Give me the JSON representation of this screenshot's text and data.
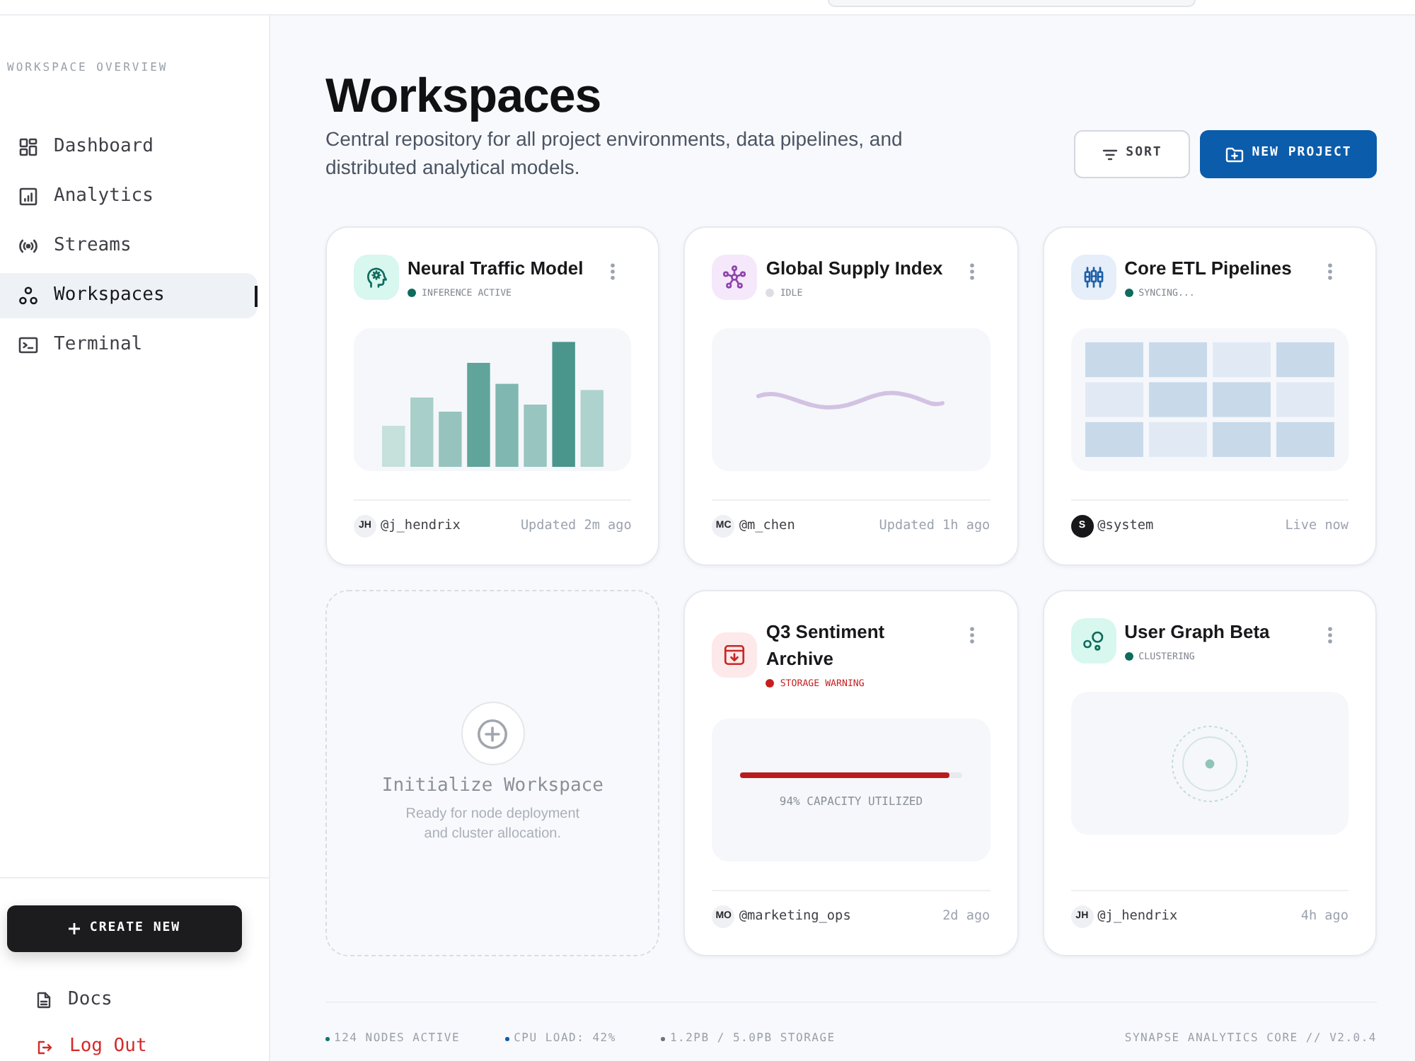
{
  "sidebar": {
    "heading": "WORKSPACE OVERVIEW",
    "nav": [
      {
        "label": "Dashboard",
        "selected": false
      },
      {
        "label": "Analytics",
        "selected": false
      },
      {
        "label": "Streams",
        "selected": false
      },
      {
        "label": "Workspaces",
        "selected": true
      },
      {
        "label": "Terminal",
        "selected": false
      }
    ],
    "create_button": "CREATE NEW",
    "links": [
      {
        "label": "Docs",
        "kind": "default"
      },
      {
        "label": "Log Out",
        "kind": "danger"
      }
    ]
  },
  "page": {
    "title": "Workspaces",
    "description": "Central repository for all project environments, data pipelines, and distributed analytical models.",
    "actions": [
      {
        "label": "SORT",
        "kind": "secondary"
      },
      {
        "label": "NEW PROJECT",
        "kind": "primary"
      }
    ]
  },
  "cards": [
    {
      "kind": "project",
      "title": "Neural Traffic Model",
      "status": {
        "label": "INFERENCE ACTIVE",
        "color": "#0f6b5c",
        "warning": false
      },
      "preview": {
        "kind": "bars"
      },
      "owner": {
        "initials": "JH",
        "handle": "@j_hendrix",
        "kind": "user"
      },
      "updated": "Updated 2m ago"
    },
    {
      "kind": "project",
      "title": "Global Supply Index",
      "status": {
        "label": "IDLE",
        "color": "#dcdee3",
        "warning": false
      },
      "preview": {
        "kind": "wave"
      },
      "owner": {
        "initials": "MC",
        "handle": "@m_chen",
        "kind": "user"
      },
      "updated": "Updated 1h ago"
    },
    {
      "kind": "project",
      "title": "Core ETL Pipelines",
      "status": {
        "label": "SYNCING...",
        "color": "#0f6b5c",
        "warning": false
      },
      "preview": {
        "kind": "grid"
      },
      "owner": {
        "initials": "S",
        "handle": "@system",
        "kind": "system"
      },
      "updated": "Live now"
    },
    {
      "kind": "placeholder",
      "title": "Initialize Workspace",
      "description": "Ready for node deployment and cluster allocation."
    },
    {
      "kind": "project",
      "title": "Q3 Sentiment Archive",
      "status": {
        "label": "STORAGE WARNING",
        "color": "#c81e1e",
        "warning": true
      },
      "preview": {
        "kind": "capacity",
        "level": 0.94,
        "label": "94% CAPACITY UTILIZED"
      },
      "owner": {
        "initials": "MO",
        "handle": "@marketing_ops",
        "kind": "user"
      },
      "updated": "2d ago"
    },
    {
      "kind": "project",
      "title": "User Graph Beta",
      "status": {
        "label": "CLUSTERING",
        "color": "#0f6b5c",
        "warning": false
      },
      "preview": {
        "kind": "rings"
      },
      "owner": {
        "initials": "JH",
        "handle": "@j_hendrix",
        "kind": "user"
      },
      "updated": "4h ago"
    }
  ],
  "status_bar": {
    "items": [
      {
        "label": "124 NODES ACTIVE",
        "color": "#0f766e"
      },
      {
        "label": "CPU LOAD: 42%",
        "color": "#0b5cab"
      },
      {
        "label": "1.2PB / 5.0PB STORAGE",
        "color": "#6b7280"
      }
    ],
    "version": "SYNAPSE ANALYTICS CORE // V2.0.4"
  }
}
